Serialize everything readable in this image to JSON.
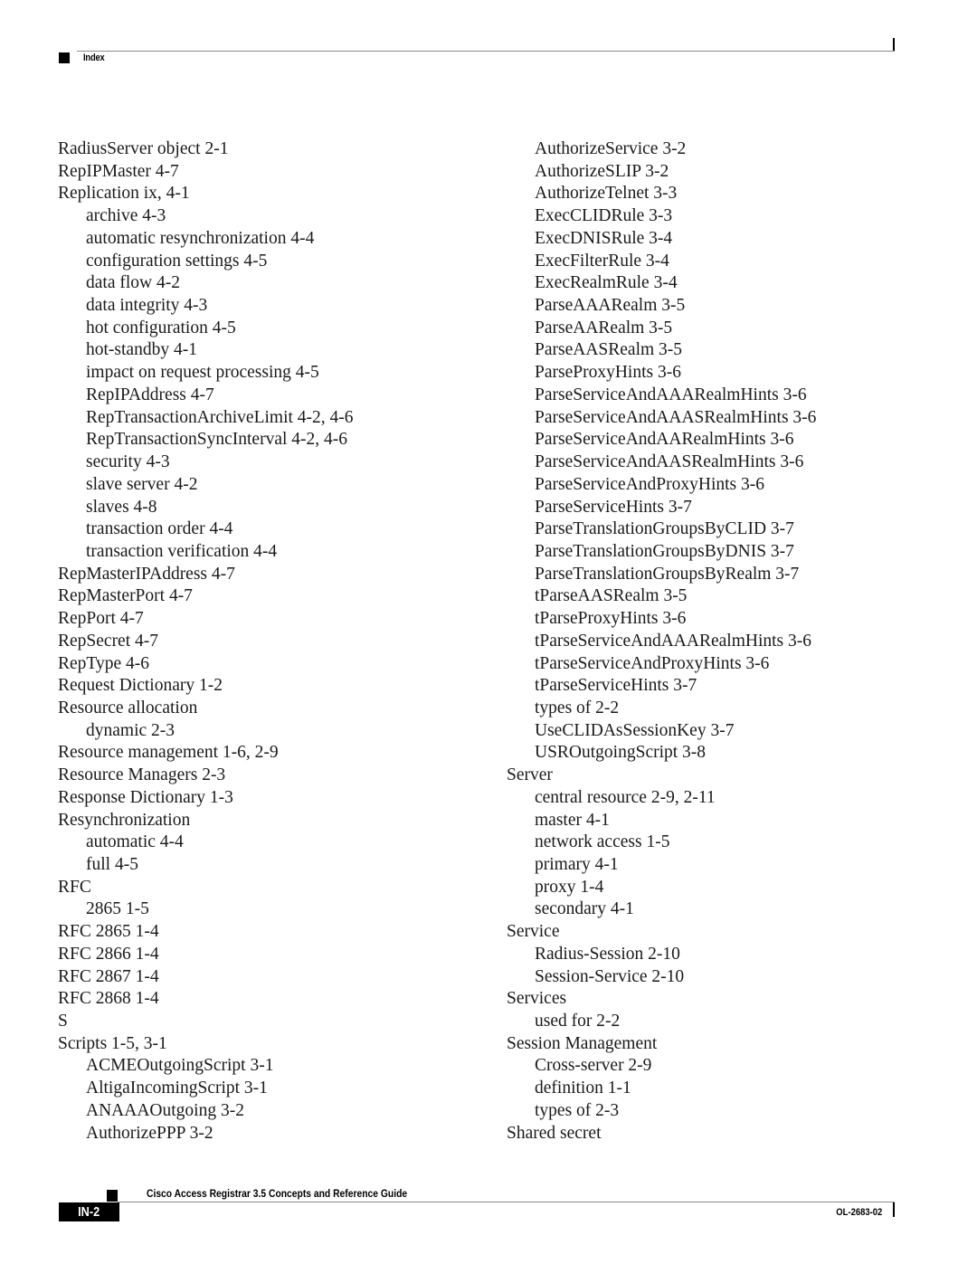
{
  "header": {
    "section_label": "Index"
  },
  "index": {
    "left_column": [
      {
        "text": "RadiusServer object 2-1",
        "level": 0
      },
      {
        "text": "RepIPMaster 4-7",
        "level": 0
      },
      {
        "text": "Replication ix, 4-1",
        "level": 0
      },
      {
        "text": "archive 4-3",
        "level": 1
      },
      {
        "text": "automatic resynchronization 4-4",
        "level": 1
      },
      {
        "text": "configuration settings 4-5",
        "level": 1
      },
      {
        "text": "data flow 4-2",
        "level": 1
      },
      {
        "text": "data integrity 4-3",
        "level": 1
      },
      {
        "text": "hot configuration 4-5",
        "level": 1
      },
      {
        "text": "hot-standby 4-1",
        "level": 1
      },
      {
        "text": "impact on request processing 4-5",
        "level": 1
      },
      {
        "text": "RepIPAddress 4-7",
        "level": 1
      },
      {
        "text": "RepTransactionArchiveLimit 4-2, 4-6",
        "level": 1
      },
      {
        "text": "RepTransactionSyncInterval 4-2, 4-6",
        "level": 1
      },
      {
        "text": "security 4-3",
        "level": 1
      },
      {
        "text": "slave server 4-2",
        "level": 1
      },
      {
        "text": "slaves 4-8",
        "level": 1
      },
      {
        "text": "transaction order 4-4",
        "level": 1
      },
      {
        "text": "transaction verification 4-4",
        "level": 1
      },
      {
        "text": "RepMasterIPAddress 4-7",
        "level": 0
      },
      {
        "text": "RepMasterPort 4-7",
        "level": 0
      },
      {
        "text": "RepPort 4-7",
        "level": 0
      },
      {
        "text": "RepSecret 4-7",
        "level": 0
      },
      {
        "text": "RepType 4-6",
        "level": 0
      },
      {
        "text": "Request Dictionary 1-2",
        "level": 0
      },
      {
        "text": "Resource allocation",
        "level": 0
      },
      {
        "text": "dynamic 2-3",
        "level": 1
      },
      {
        "text": "Resource management 1-6, 2-9",
        "level": 0
      },
      {
        "text": "Resource Managers 2-3",
        "level": 0
      },
      {
        "text": "Response Dictionary 1-3",
        "level": 0
      },
      {
        "text": "Resynchronization",
        "level": 0
      },
      {
        "text": "automatic 4-4",
        "level": 1
      },
      {
        "text": "full 4-5",
        "level": 1
      },
      {
        "text": "RFC",
        "level": 0
      },
      {
        "text": "2865 1-5",
        "level": 1
      },
      {
        "text": "RFC 2865 1-4",
        "level": 0
      },
      {
        "text": "RFC 2866 1-4",
        "level": 0
      },
      {
        "text": "RFC 2867 1-4",
        "level": 0
      },
      {
        "text": "RFC 2868 1-4",
        "level": 0
      },
      {
        "text": "S",
        "level": 0
      },
      {
        "text": "Scripts 1-5, 3-1",
        "level": 0
      },
      {
        "text": "ACMEOutgoingScript 3-1",
        "level": 1
      },
      {
        "text": "AltigaIncomingScript 3-1",
        "level": 1
      },
      {
        "text": "ANAAAOutgoing 3-2",
        "level": 1
      },
      {
        "text": "AuthorizePPP 3-2",
        "level": 1
      }
    ],
    "right_column": [
      {
        "text": "AuthorizeService 3-2",
        "level": 1
      },
      {
        "text": "AuthorizeSLIP 3-2",
        "level": 1
      },
      {
        "text": "AuthorizeTelnet 3-3",
        "level": 1
      },
      {
        "text": "ExecCLIDRule 3-3",
        "level": 1
      },
      {
        "text": "ExecDNISRule 3-4",
        "level": 1
      },
      {
        "text": "ExecFilterRule 3-4",
        "level": 1
      },
      {
        "text": "ExecRealmRule 3-4",
        "level": 1
      },
      {
        "text": "ParseAAARealm 3-5",
        "level": 1
      },
      {
        "text": "ParseAARealm 3-5",
        "level": 1
      },
      {
        "text": "ParseAASRealm 3-5",
        "level": 1
      },
      {
        "text": "ParseProxyHints 3-6",
        "level": 1
      },
      {
        "text": "ParseServiceAndAAARealmHints 3-6",
        "level": 1
      },
      {
        "text": "ParseServiceAndAAASRealmHints 3-6",
        "level": 1
      },
      {
        "text": "ParseServiceAndAARealmHints 3-6",
        "level": 1
      },
      {
        "text": "ParseServiceAndAASRealmHints 3-6",
        "level": 1
      },
      {
        "text": "ParseServiceAndProxyHints 3-6",
        "level": 1
      },
      {
        "text": "ParseServiceHints 3-7",
        "level": 1
      },
      {
        "text": "ParseTranslationGroupsByCLID 3-7",
        "level": 1
      },
      {
        "text": "ParseTranslationGroupsByDNIS 3-7",
        "level": 1
      },
      {
        "text": "ParseTranslationGroupsByRealm 3-7",
        "level": 1
      },
      {
        "text": "tParseAASRealm 3-5",
        "level": 1
      },
      {
        "text": "tParseProxyHints 3-6",
        "level": 1
      },
      {
        "text": "tParseServiceAndAAARealmHints 3-6",
        "level": 1
      },
      {
        "text": "tParseServiceAndProxyHints 3-6",
        "level": 1
      },
      {
        "text": "tParseServiceHints 3-7",
        "level": 1
      },
      {
        "text": "types of 2-2",
        "level": 1
      },
      {
        "text": "UseCLIDAsSessionKey 3-7",
        "level": 1
      },
      {
        "text": "USROutgoingScript 3-8",
        "level": 1
      },
      {
        "text": "Server",
        "level": 0
      },
      {
        "text": "central resource 2-9, 2-11",
        "level": 1
      },
      {
        "text": "master 4-1",
        "level": 1
      },
      {
        "text": "network access 1-5",
        "level": 1
      },
      {
        "text": "primary 4-1",
        "level": 1
      },
      {
        "text": "proxy 1-4",
        "level": 1
      },
      {
        "text": "secondary 4-1",
        "level": 1
      },
      {
        "text": "Service",
        "level": 0
      },
      {
        "text": "Radius-Session 2-10",
        "level": 1
      },
      {
        "text": "Session-Service 2-10",
        "level": 1
      },
      {
        "text": "Services",
        "level": 0
      },
      {
        "text": "used for 2-2",
        "level": 1
      },
      {
        "text": "Session Management",
        "level": 0
      },
      {
        "text": "Cross-server 2-9",
        "level": 1
      },
      {
        "text": "definition 1-1",
        "level": 1
      },
      {
        "text": "types of 2-3",
        "level": 1
      },
      {
        "text": "Shared secret",
        "level": 0
      }
    ]
  },
  "footer": {
    "book_title": "Cisco Access Registrar 3.5 Concepts and Reference Guide",
    "page_number": "IN-2",
    "doc_number": "OL-2683-02"
  }
}
